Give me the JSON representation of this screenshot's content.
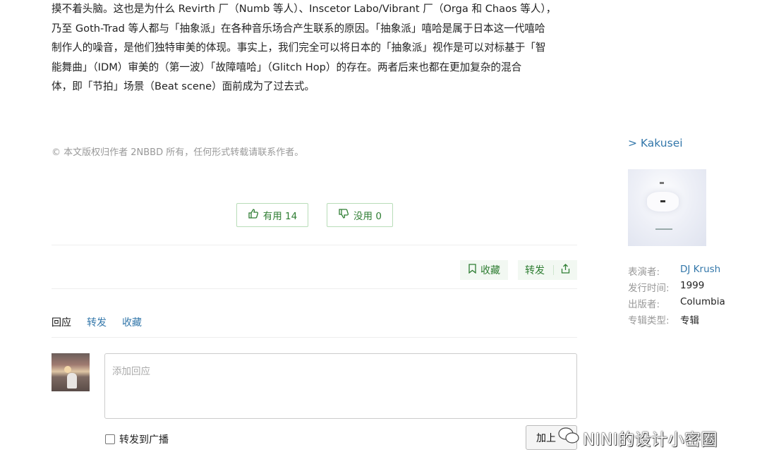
{
  "article": {
    "lines": [
      "摸不着头脑。这也是为什么 Revirth 厂（Numb 等人）、Inscetor Labo/Vibrant 厂（Orga 和 Chaos 等人），",
      "乃至 Goth-Trad 等人都与「抽象派」在各种音乐场合产生联系的原因。「抽象派」嘻哈是属于日本这一代嘻哈",
      "制作人的噪音，是他们独特审美的体现。事实上，我们完全可以将日本的「抽象派」视作是可以对标基于「智",
      "能舞曲」（IDM）审美的（第一波）「故障嘻哈」（Glitch Hop）的存在。两者后来也都在更加复杂的混合",
      "体，即「节拍」场景（Beat scene）面前成为了过去式。"
    ],
    "copyright": "© 本文版权归作者  2NBBD  所有，任何形式转载请联系作者。"
  },
  "votes": {
    "useful_label": "有用 14",
    "useless_label": "没用 0"
  },
  "actions": {
    "favorite_label": "收藏",
    "share_label": "转发"
  },
  "tabs": [
    {
      "label": "回应"
    },
    {
      "label": "转发"
    },
    {
      "label": "收藏"
    }
  ],
  "reply": {
    "placeholder": "添加回应",
    "repost_label": "转发到广播",
    "submit_label": "加上"
  },
  "watermark": "NINI的设计小密圈",
  "sidebar": {
    "title": "> Kakusei",
    "meta": [
      {
        "key": "表演者:",
        "value": "DJ Krush"
      },
      {
        "key": "发行时间:",
        "value": "1999"
      },
      {
        "key": "出版者:",
        "value": "Columbia"
      },
      {
        "key": "专辑类型:",
        "value": "专辑"
      }
    ]
  },
  "colors": {
    "link": "#3377aa",
    "green": "#2e7d32",
    "green_border": "#b8ddb8",
    "muted": "#999999"
  }
}
